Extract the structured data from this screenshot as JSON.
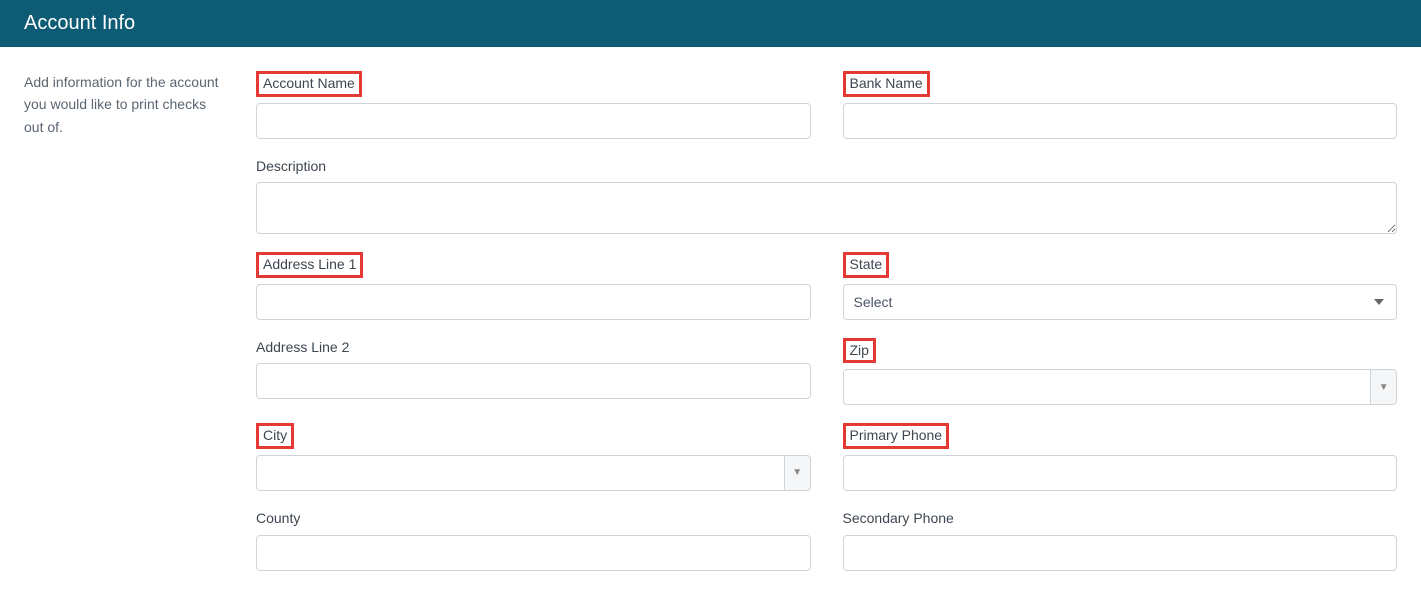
{
  "header": {
    "title": "Account Info"
  },
  "sidebar": {
    "description": "Add information for the account you would like to print checks out of."
  },
  "form": {
    "account_name": {
      "label": "Account Name",
      "value": "",
      "highlighted": true
    },
    "bank_name": {
      "label": "Bank Name",
      "value": "",
      "highlighted": true
    },
    "description": {
      "label": "Description",
      "value": "",
      "highlighted": false
    },
    "address_line_1": {
      "label": "Address Line 1",
      "value": "",
      "highlighted": true
    },
    "address_line_2": {
      "label": "Address Line 2",
      "value": "",
      "highlighted": false
    },
    "city": {
      "label": "City",
      "value": "",
      "highlighted": true
    },
    "county": {
      "label": "County",
      "value": "",
      "highlighted": false
    },
    "state": {
      "label": "State",
      "selected": "Select",
      "highlighted": true
    },
    "zip": {
      "label": "Zip",
      "value": "",
      "highlighted": true
    },
    "primary_phone": {
      "label": "Primary Phone",
      "value": "",
      "highlighted": true
    },
    "secondary_phone": {
      "label": "Secondary Phone",
      "value": "",
      "highlighted": false
    }
  }
}
